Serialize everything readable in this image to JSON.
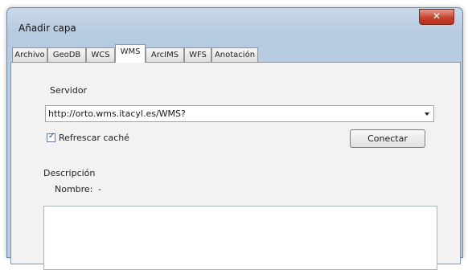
{
  "window": {
    "title": "Añadir capa",
    "close_glyph": "✕"
  },
  "tabs": [
    {
      "label": "Archivo"
    },
    {
      "label": "GeoDB"
    },
    {
      "label": "WCS"
    },
    {
      "label": "WMS"
    },
    {
      "label": "ArcIMS"
    },
    {
      "label": "WFS"
    },
    {
      "label": "Anotación"
    }
  ],
  "active_tab": "WMS",
  "servidor": {
    "label": "Servidor",
    "value": "http://orto.wms.itacyl.es/WMS?"
  },
  "refrescar": {
    "label": "Refrescar caché",
    "checked": true,
    "check_glyph": "✓"
  },
  "conectar_button": "Conectar",
  "descripcion": {
    "label": "Descripción",
    "nombre_label": "Nombre:",
    "nombre_value": "-"
  }
}
